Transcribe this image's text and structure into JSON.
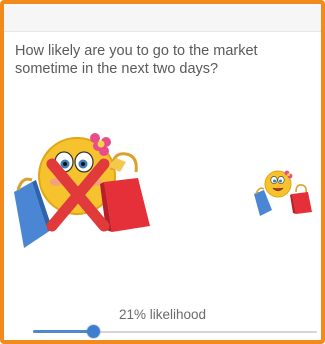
{
  "survey": {
    "question": "How likely are you to go to the market sometime in the next two days?",
    "likelihood_label": "21% likelihood",
    "likelihood_value": 21,
    "slider_min": 0,
    "slider_max": 100
  },
  "illustrations": {
    "left": "shopping-emoji-crossed-out",
    "right": "shopping-emoji"
  },
  "colors": {
    "frame": "#f28a1e",
    "slider_accent": "#3f7dcf",
    "text": "#5a5a5a"
  }
}
